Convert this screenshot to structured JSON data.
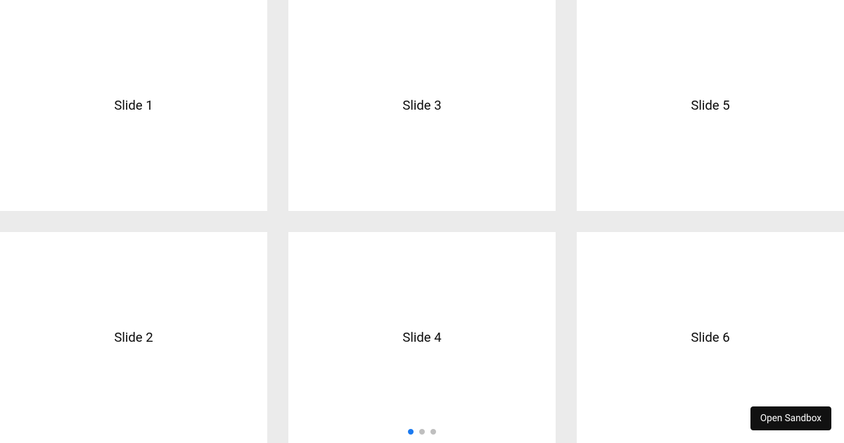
{
  "slides": [
    {
      "label": "Slide 1"
    },
    {
      "label": "Slide 2"
    },
    {
      "label": "Slide 3"
    },
    {
      "label": "Slide 4"
    },
    {
      "label": "Slide 5"
    },
    {
      "label": "Slide 6"
    }
  ],
  "pagination": {
    "count": 3,
    "active_index": 0
  },
  "sandbox_button": {
    "label": "Open Sandbox"
  }
}
